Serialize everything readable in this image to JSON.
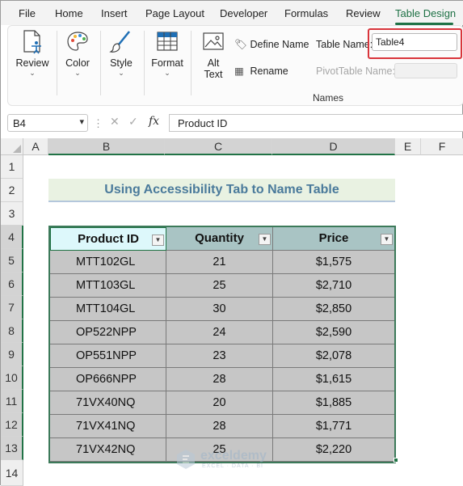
{
  "menu": {
    "tabs": [
      "File",
      "Home",
      "Insert",
      "Page Layout",
      "Developer",
      "Formulas",
      "Review",
      "Table Design"
    ],
    "active_tab": "Table Design"
  },
  "ribbon": {
    "review": "Review",
    "color": "Color",
    "style": "Style",
    "format": "Format",
    "alt_text_line1": "Alt",
    "alt_text_line2": "Text",
    "define_name": "Define Name",
    "rename": "Rename",
    "table_name_label": "Table Name:",
    "table_name_value": "Table4",
    "pivottable_name_label": "PivotTable Name:",
    "group_label": "Names",
    "chevron": "⌄"
  },
  "formula_bar": {
    "name_box": "B4",
    "formula": "Product ID"
  },
  "sheet": {
    "columns": [
      "A",
      "B",
      "C",
      "D",
      "E",
      "F"
    ],
    "rows": [
      "1",
      "2",
      "3",
      "4",
      "5",
      "6",
      "7",
      "8",
      "9",
      "10",
      "11",
      "12",
      "13",
      "14"
    ],
    "title": "Using Accessibility Tab to Name Table",
    "table": {
      "headers": [
        "Product ID",
        "Quantity",
        "Price"
      ],
      "rows": [
        [
          "MTT102GL",
          "21",
          "$1,575"
        ],
        [
          "MTT103GL",
          "25",
          "$2,710"
        ],
        [
          "MTT104GL",
          "30",
          "$2,850"
        ],
        [
          "OP522NPP",
          "24",
          "$2,590"
        ],
        [
          "OP551NPP",
          "23",
          "$2,078"
        ],
        [
          "OP666NPP",
          "28",
          "$1,615"
        ],
        [
          "71VX40NQ",
          "20",
          "$1,885"
        ],
        [
          "71VX41NQ",
          "28",
          "$1,771"
        ],
        [
          "71VX42NQ",
          "25",
          "$2,220"
        ]
      ]
    }
  },
  "watermark": {
    "title": "exceldemy",
    "subtitle": "EXCEL · DATA · BI"
  },
  "colors": {
    "accent": "#1e7145",
    "highlight": "#d9353b",
    "header_fill": "#a9c4c4",
    "row_fill": "#c6c6c6",
    "title_fill": "#e9f2e2"
  }
}
